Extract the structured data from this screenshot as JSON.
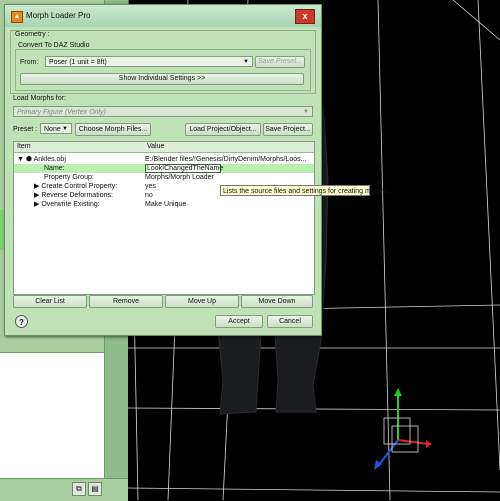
{
  "dialog": {
    "title": "Morph Loader Pro",
    "close_label": "x",
    "geometry_label": "Geometry :",
    "convert_label": "Convert To DAZ Studio",
    "from_label": "From:",
    "from_value": "Poser (1 unit = 8ft)",
    "save_preset_label": "Save Preset...",
    "show_settings_label": "Show Individual Settings >>",
    "load_morphs_label": "Load Morphs for:",
    "load_morphs_value": "Primary Figure (Vertex Only)",
    "preset_label": "Preset :",
    "preset_value": "None",
    "choose_files_label": "Choose Morph Files...",
    "load_project_label": "Load Project/Object...",
    "save_project_label": "Save Project...",
    "tree": {
      "col_item": "Item",
      "col_value": "Value",
      "root_item": "Ankles.obj",
      "root_value": "E:/Blender files/!Genesis/DirtyDenim/Morphs/Loos...",
      "rows": [
        {
          "item": "Name:",
          "value": "LookIChangedTheName"
        },
        {
          "item": "Property Group:",
          "value": "Morphs/Morph Loader"
        },
        {
          "item": "Create Control Property:",
          "value": "yes"
        },
        {
          "item": "Reverse Deformations:",
          "value": "no"
        },
        {
          "item": "Overwrite Existing:",
          "value": "Make Unique"
        }
      ]
    },
    "tooltip": "Lists the source files and settings for creating morphs.",
    "clear_list_label": "Clear List",
    "remove_label": "Remove",
    "move_up_label": "Move Up",
    "move_down_label": "Move Down",
    "help_label": "?",
    "accept_label": "Accept",
    "cancel_label": "Cancel"
  },
  "colors": {
    "dialog_bg": "#bfe3b6",
    "selected_row": "#b9f0b0",
    "tooltip_bg": "#ffffd0",
    "close_button": "#c93a2c"
  },
  "icons": [
    "morph-loader-icon",
    "close-icon",
    "object-icon",
    "expand-arrow-icon",
    "help-icon",
    "copy-icon",
    "document-icon"
  ]
}
